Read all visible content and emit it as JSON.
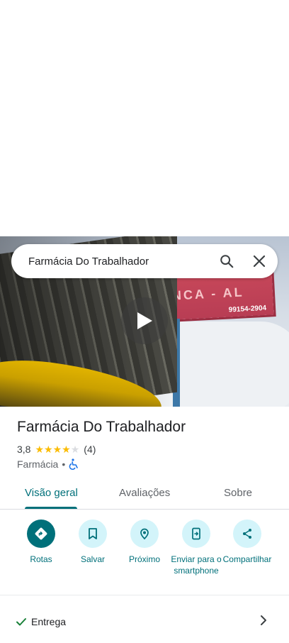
{
  "search": {
    "query": "Farmácia Do Trabalhador"
  },
  "hero": {
    "billboard_text": "BRANCA - AL",
    "billboard_phone": "99154-2904"
  },
  "place": {
    "name": "Farmácia Do Trabalhador",
    "rating": "3,8",
    "stars_filled": 4,
    "stars_total": 5,
    "review_count": "(4)",
    "category": "Farmácia",
    "separator": "•"
  },
  "tabs": [
    {
      "label": "Visão geral",
      "active": true
    },
    {
      "label": "Avaliações",
      "active": false
    },
    {
      "label": "Sobre",
      "active": false
    }
  ],
  "actions": [
    {
      "label": "Rotas",
      "icon": "directions-icon"
    },
    {
      "label": "Salvar",
      "icon": "bookmark-icon"
    },
    {
      "label": "Próximo",
      "icon": "nearby-icon"
    },
    {
      "label": "Enviar para o smartphone",
      "icon": "send-to-phone-icon"
    },
    {
      "label": "Compartilhar",
      "icon": "share-icon"
    }
  ],
  "attributes": [
    {
      "label": "Entrega",
      "icon": "check-icon"
    }
  ],
  "colors": {
    "accent": "#00707a",
    "accent_light": "#d3f4fa",
    "star": "#fbbc04",
    "star_empty": "#dadce0",
    "check": "#188038"
  }
}
